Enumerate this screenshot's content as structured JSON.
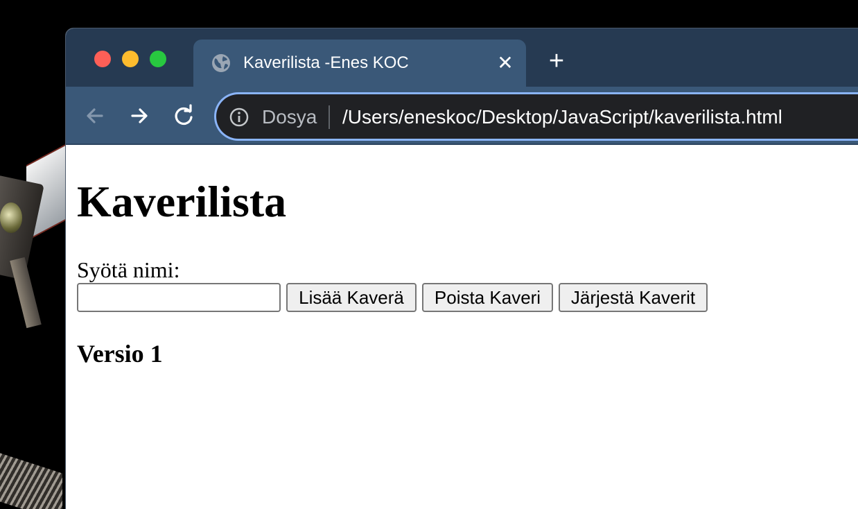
{
  "tab": {
    "title": "Kaverilista -Enes KOC",
    "close_glyph": "✕"
  },
  "toolbar": {
    "new_tab_glyph": "+",
    "scheme_label": "Dosya",
    "url": "/Users/eneskoc/Desktop/JavaScript/kaverilista.html"
  },
  "page": {
    "heading": "Kaverilista",
    "input_label": "Syötä nimi:",
    "input_value": "",
    "add_button": "Lisää Kaverä",
    "remove_button": "Poista Kaveri",
    "sort_button": "Järjestä Kaverit",
    "version": "Versio 1"
  },
  "icons": {
    "tab_favicon": "globe-icon",
    "back": "arrow-left-icon",
    "forward": "arrow-right-icon",
    "reload": "reload-icon",
    "site_info": "info-icon"
  },
  "colors": {
    "titlebar": "#263a52",
    "tab_active": "#3a5878",
    "omnibox_bg": "#202124",
    "omnibox_focus": "#8ab4f8",
    "traffic_close": "#fe5f57",
    "traffic_min": "#febc2e",
    "traffic_max": "#28c840"
  }
}
